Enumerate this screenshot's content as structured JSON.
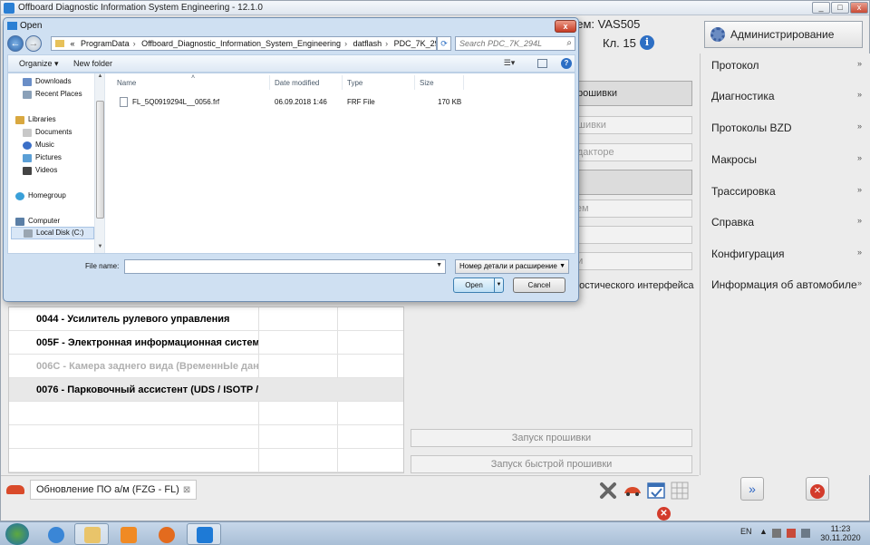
{
  "window": {
    "title": "Offboard Diagnostic Information System Engineering - 12.1.0",
    "controls": {
      "min": "_",
      "max": "□",
      "close": "x"
    }
  },
  "header": {
    "system_label": "ием:  VAS505",
    "kl_label": "Кл. 15",
    "admin_button": "Администрирование"
  },
  "sidebar": {
    "items": [
      {
        "label": "Протокол",
        "chevron": "»"
      },
      {
        "label": "Диагностика",
        "chevron": "»"
      },
      {
        "label": "Протоколы BZD",
        "chevron": "»"
      },
      {
        "label": "Макросы",
        "chevron": "»"
      },
      {
        "label": "Трассировка",
        "chevron": "»"
      },
      {
        "label": "Справка",
        "chevron": "»"
      },
      {
        "label": "Конфигурация",
        "chevron": "»"
      },
      {
        "label": "Информация об автомобиле",
        "chevron": "»"
      }
    ]
  },
  "middle": {
    "buttons": [
      {
        "label": "прошивки",
        "style": "dark"
      },
      {
        "label": "ошивки",
        "style": "light"
      },
      {
        "label": "едакторе",
        "style": "light"
      },
      {
        "label": "2",
        "style": "dark"
      },
      {
        "label": "тем",
        "style": "light"
      },
      {
        "label": "а",
        "style": "light"
      },
      {
        "label": "ии",
        "style": "light"
      }
    ],
    "interface_text": "ностического интерфейса",
    "flash_start": "Запуск прошивки",
    "quick_flash_start": "Запуск быстрой прошивки"
  },
  "table": {
    "rows": [
      {
        "text": "0044 - Усилитель рулевого управления",
        "state": "normal"
      },
      {
        "text": "005F - Электронная информационная система",
        "state": "normal"
      },
      {
        "text": "006C - Камера заднего вида  (ВременнЫе данн",
        "state": "dim"
      },
      {
        "text": "0076 - Парковочный ассистент  (UDS / ISOTP / I",
        "state": "selected"
      },
      {
        "text": "",
        "state": "normal"
      },
      {
        "text": "",
        "state": "normal"
      },
      {
        "text": "",
        "state": "normal"
      }
    ]
  },
  "tabbar": {
    "tab_label": "Обновление ПО а/м (FZG - FL)",
    "tab_close": "⊠"
  },
  "dialog": {
    "title": "Open",
    "close": "x",
    "address": [
      "«",
      "ProgramData",
      "Offboard_Diagnostic_Information_System_Engineering",
      "datflash",
      "PDC_7K_294L"
    ],
    "search_placeholder": "Search PDC_7K_294L",
    "organize": "Organize ▾",
    "new_folder": "New folder",
    "nav_items": [
      {
        "label": "Downloads",
        "color": "#6a8ec7",
        "indent": 1
      },
      {
        "label": "Recent Places",
        "color": "#8aa0b8",
        "indent": 1
      },
      {
        "label": "",
        "color": "",
        "indent": 0
      },
      {
        "label": "Libraries",
        "color": "#d9a840",
        "indent": 0
      },
      {
        "label": "Documents",
        "color": "#c8c8c8",
        "indent": 1
      },
      {
        "label": "Music",
        "color": "#3b6fc7",
        "indent": 1
      },
      {
        "label": "Pictures",
        "color": "#5b9fd6",
        "indent": 1
      },
      {
        "label": "Videos",
        "color": "#444",
        "indent": 1
      },
      {
        "label": "",
        "color": "",
        "indent": 0
      },
      {
        "label": "Homegroup",
        "color": "#3aa0d9",
        "indent": 0
      },
      {
        "label": "",
        "color": "",
        "indent": 0
      },
      {
        "label": "Computer",
        "color": "#5b7fa6",
        "indent": 0
      },
      {
        "label": "Local Disk (C:)",
        "color": "#9aa6b2",
        "indent": 1,
        "selected": true
      }
    ],
    "columns": [
      "Name",
      "Date modified",
      "Type",
      "Size"
    ],
    "files": [
      {
        "name": "FL_5Q0919294L__0056.frf",
        "date": "06.09.2018 1:46",
        "type": "FRF File",
        "size": "170 KB"
      }
    ],
    "file_name_label": "File name:",
    "file_name_value": "",
    "filter": "Номер детали и расширение",
    "open_button": "Open",
    "cancel_button": "Cancel"
  },
  "taskbar": {
    "lang": "EN",
    "time": "11:23",
    "date": "30.11.2020"
  }
}
